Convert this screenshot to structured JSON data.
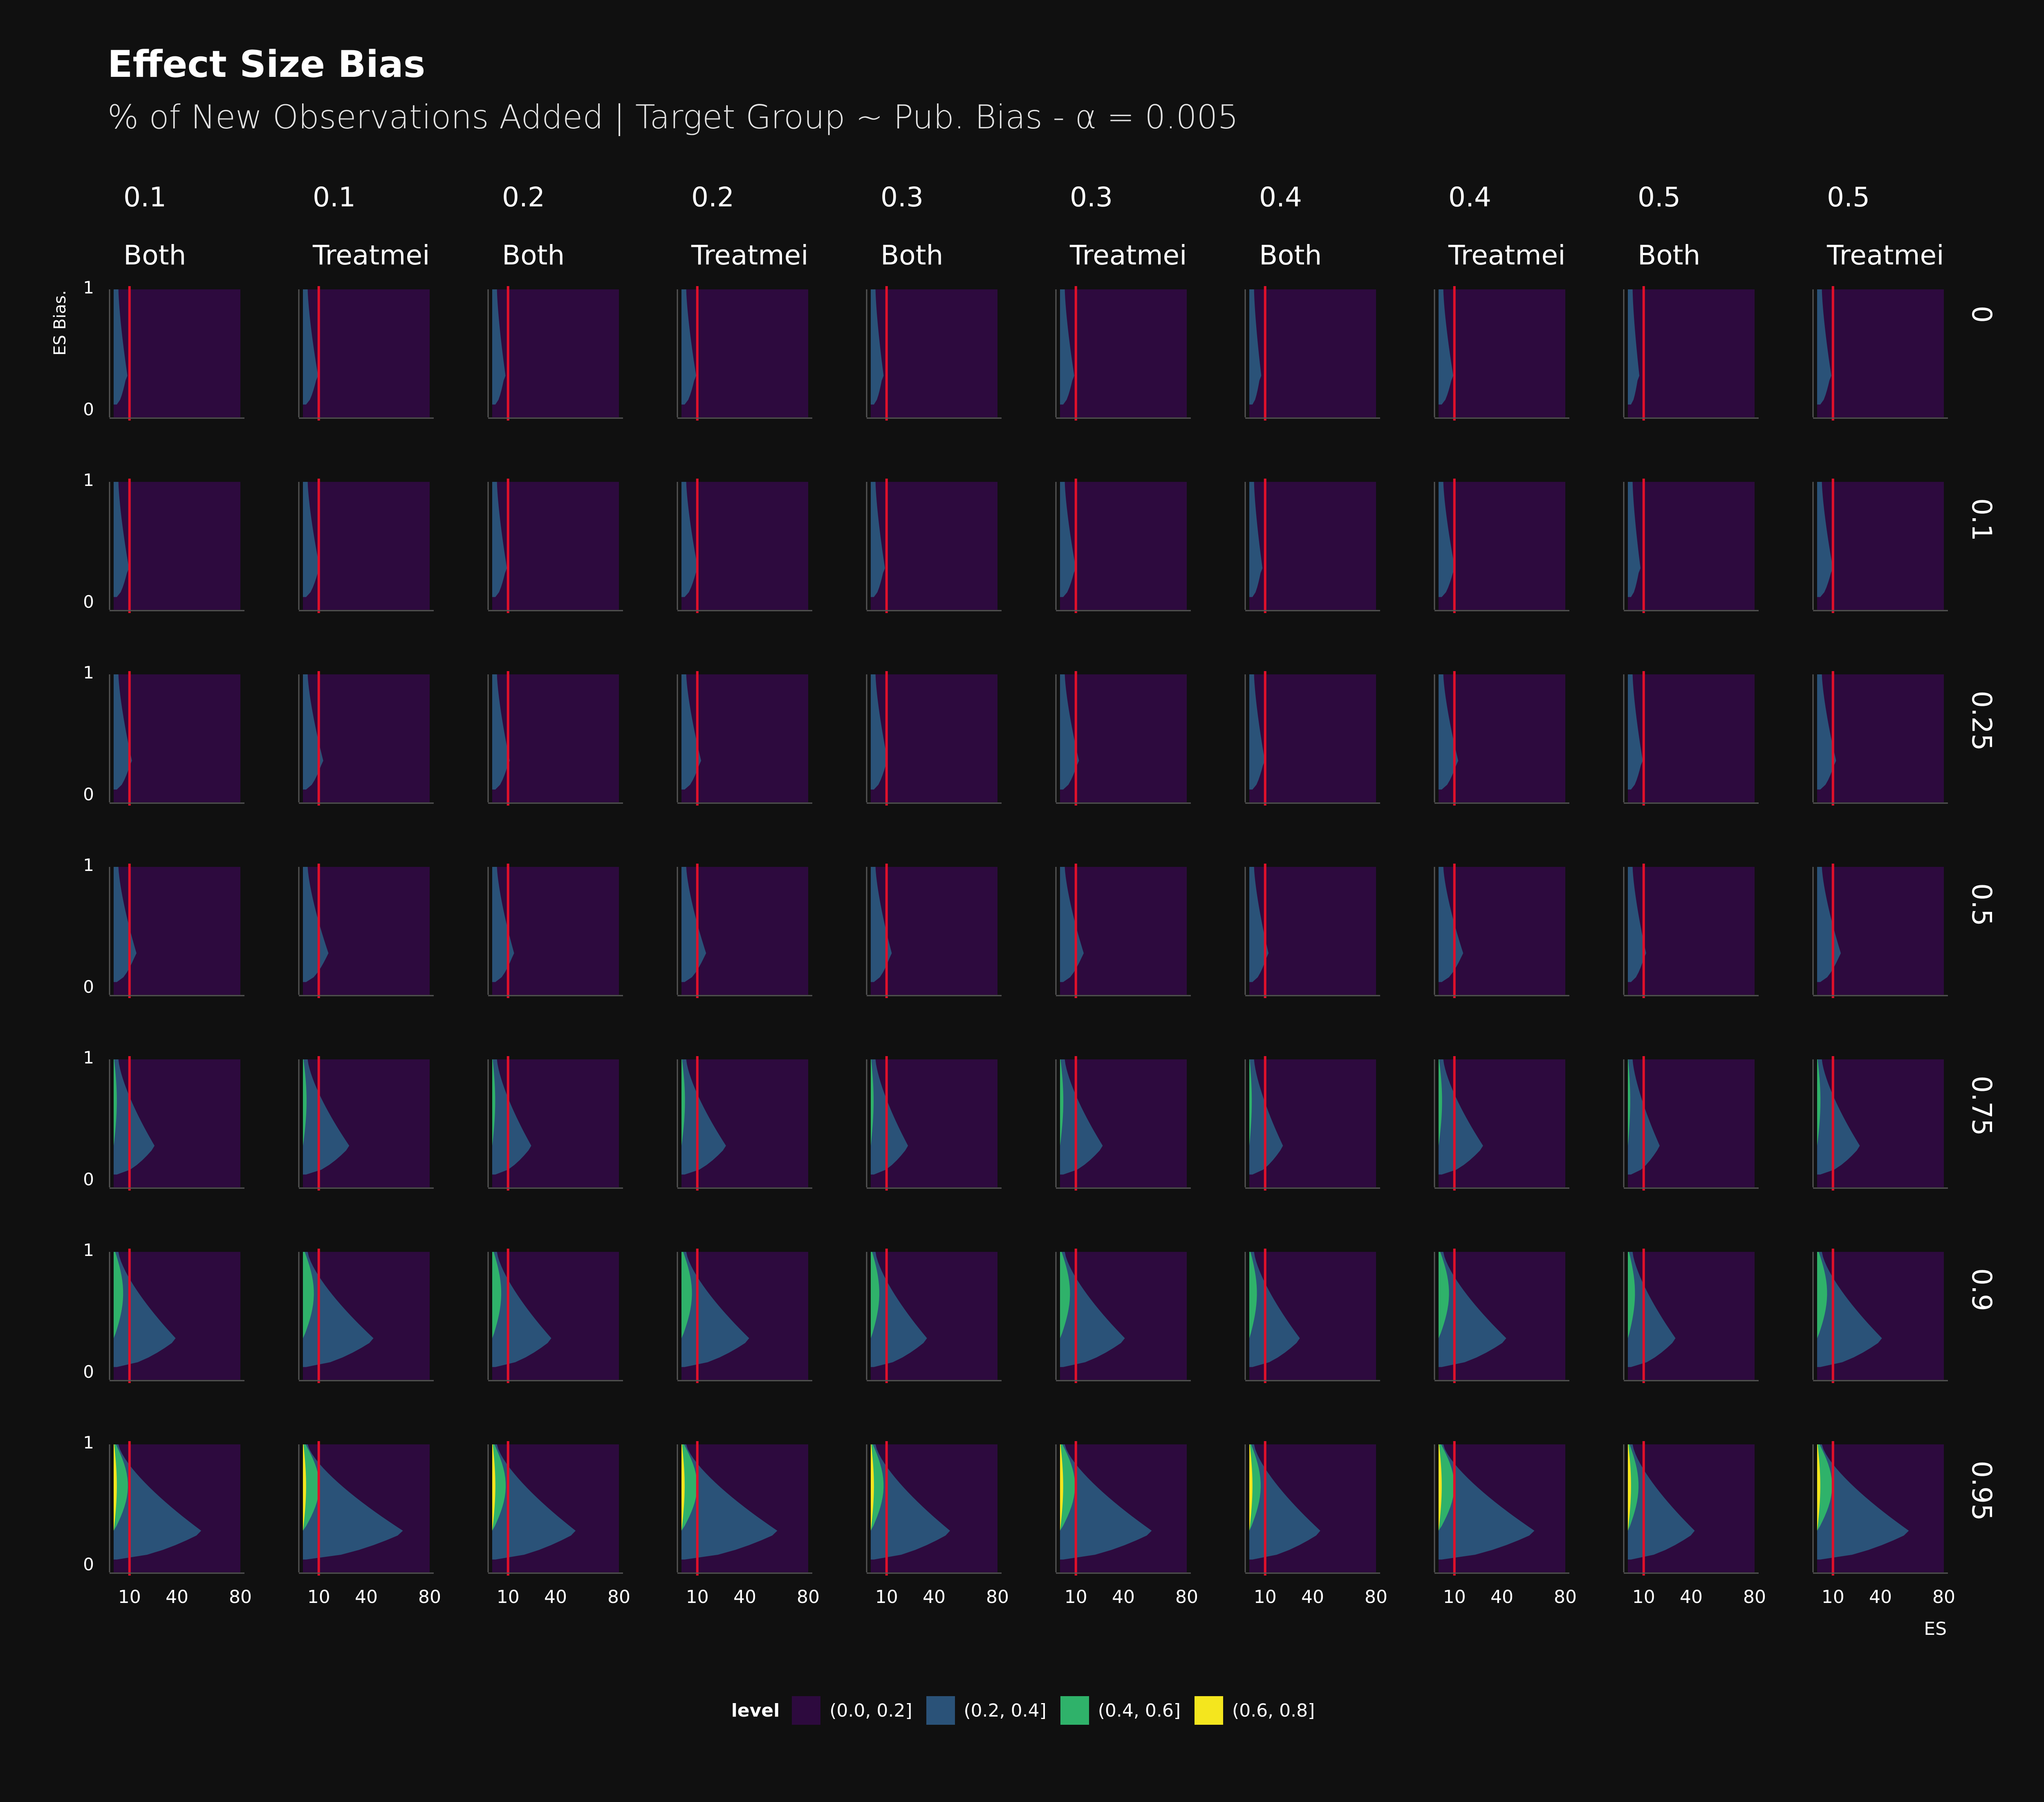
{
  "header": {
    "title": "Effect Size Bias",
    "subtitle": "% of New Observations Added | Target Group ~ Pub. Bias - α = 0.005"
  },
  "legend": {
    "title": "level",
    "items": [
      {
        "label": "(0.0, 0.2]",
        "color": "#2d0a3e"
      },
      {
        "label": "(0.2, 0.4]",
        "color": "#2a5278"
      },
      {
        "label": "(0.4, 0.6]",
        "color": "#2fb26a"
      },
      {
        "label": "(0.6, 0.8]",
        "color": "#f4e61e"
      }
    ]
  },
  "chart_data": {
    "type": "contour",
    "xlabel": "ES",
    "ylabel": "ES Bias.",
    "x_ticks": [
      "10",
      "40",
      "80"
    ],
    "x_range": [
      0,
      80
    ],
    "y_ticks": [
      "0",
      "1"
    ],
    "y_range": [
      0,
      1
    ],
    "reference_line_x": 10,
    "reference_line_color": "#e0102a",
    "col_facets": [
      {
        "top": "0.1",
        "bottom": "Both"
      },
      {
        "top": "0.1",
        "bottom": "Treatmei"
      },
      {
        "top": "0.2",
        "bottom": "Both"
      },
      {
        "top": "0.2",
        "bottom": "Treatmei"
      },
      {
        "top": "0.3",
        "bottom": "Both"
      },
      {
        "top": "0.3",
        "bottom": "Treatmei"
      },
      {
        "top": "0.4",
        "bottom": "Both"
      },
      {
        "top": "0.4",
        "bottom": "Treatmei"
      },
      {
        "top": "0.5",
        "bottom": "Both"
      },
      {
        "top": "0.5",
        "bottom": "Treatmei"
      }
    ],
    "row_facets": [
      "0",
      "0.1",
      "0.25",
      "0.5",
      "0.75",
      "0.9",
      "0.95"
    ],
    "levels": [
      "(0.0, 0.2]",
      "(0.2, 0.4]",
      "(0.4, 0.6]",
      "(0.6, 0.8]"
    ],
    "row_band_extent": [
      {
        "blue_max_es": 6,
        "green_max_es": 0,
        "yellow_max_es": 0
      },
      {
        "blue_max_es": 7,
        "green_max_es": 0,
        "yellow_max_es": 0
      },
      {
        "blue_max_es": 9,
        "green_max_es": 0,
        "yellow_max_es": 0
      },
      {
        "blue_max_es": 12,
        "green_max_es": 0,
        "yellow_max_es": 0
      },
      {
        "blue_max_es": 24,
        "green_max_es": 2,
        "yellow_max_es": 0
      },
      {
        "blue_max_es": 38,
        "green_max_es": 6,
        "yellow_max_es": 0
      },
      {
        "blue_max_es": 55,
        "green_max_es": 9,
        "yellow_max_es": 2
      }
    ],
    "col_scale": [
      1.0,
      1.15,
      0.95,
      1.1,
      0.9,
      1.05,
      0.8,
      1.1,
      0.75,
      1.05
    ]
  }
}
